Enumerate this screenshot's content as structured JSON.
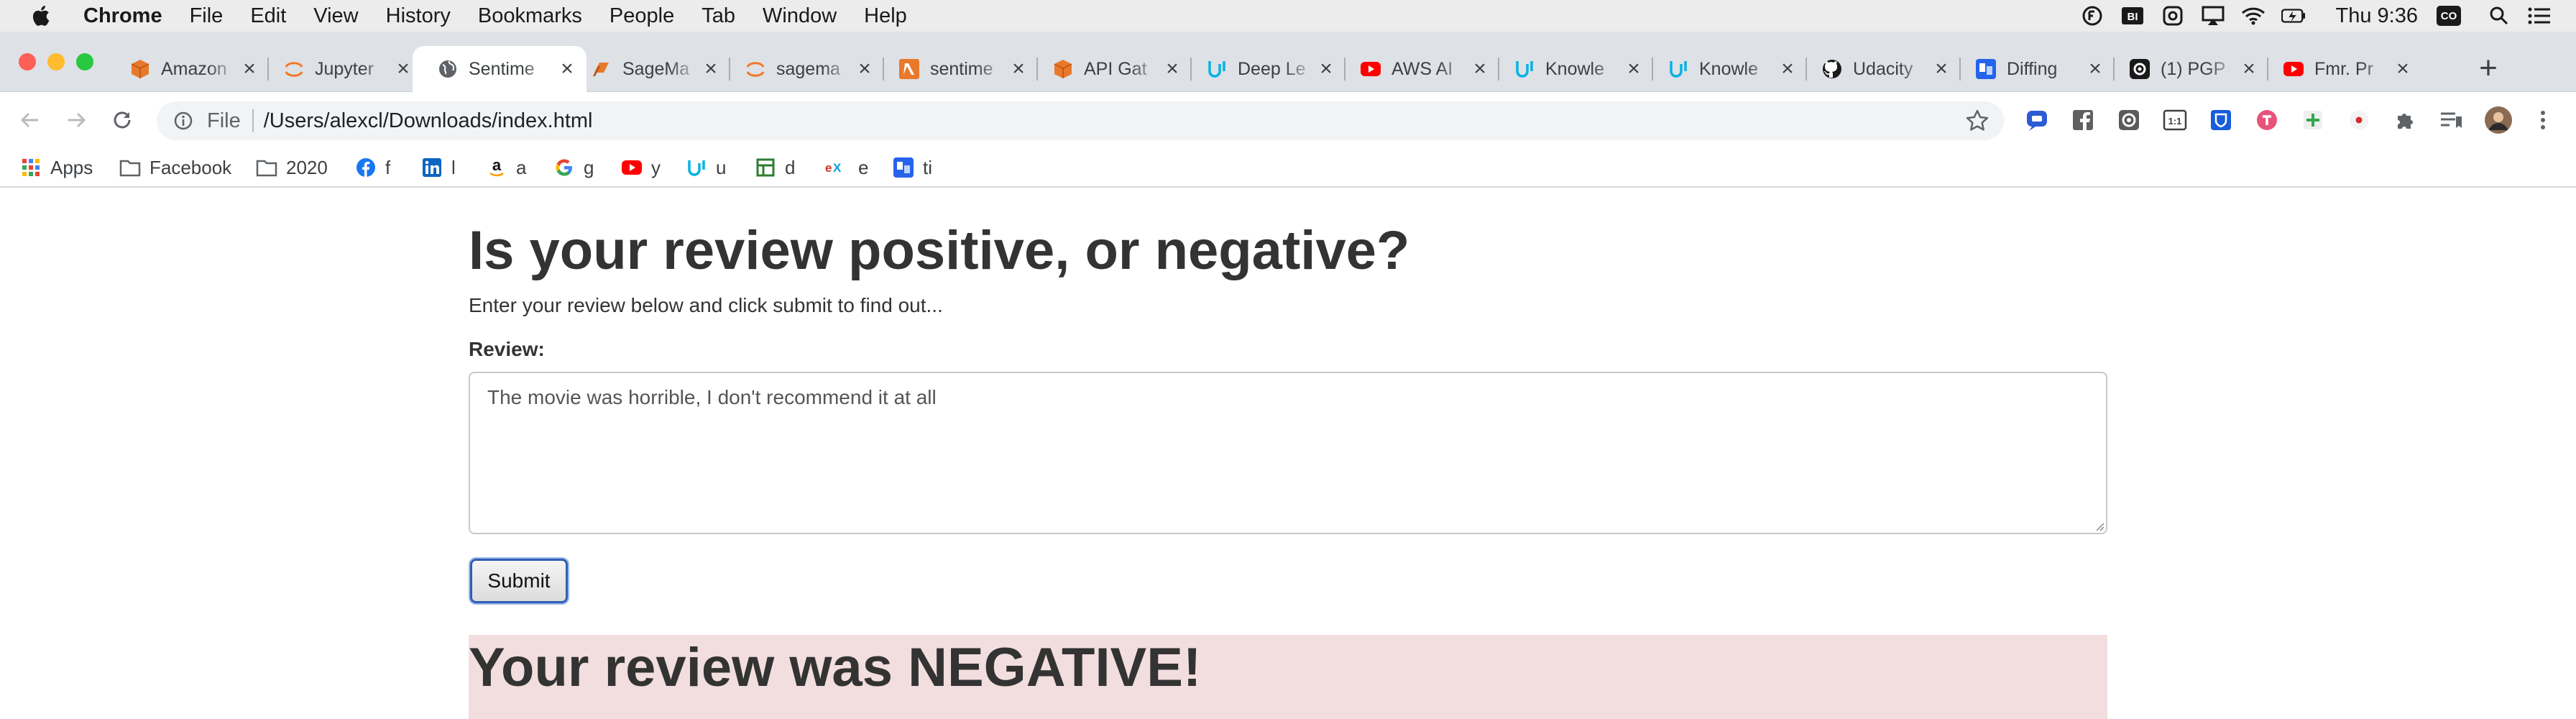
{
  "menubar": {
    "app_name": "Chrome",
    "menus": [
      "File",
      "Edit",
      "View",
      "History",
      "Bookmarks",
      "People",
      "Tab",
      "Window",
      "Help"
    ],
    "clock": "Thu 9:36",
    "user_initials": "CO"
  },
  "tabs": [
    {
      "title": "Amazon",
      "icon": "amazon-box-icon"
    },
    {
      "title": "Jupyter",
      "icon": "jupyter-icon"
    },
    {
      "title": "Sentime",
      "icon": "globe-icon",
      "active": true
    },
    {
      "title": "SageMa",
      "icon": "sagemaker-icon"
    },
    {
      "title": "sagema",
      "icon": "jupyter-icon"
    },
    {
      "title": "sentime",
      "icon": "lambda-icon"
    },
    {
      "title": "API Gat",
      "icon": "amazon-box-icon"
    },
    {
      "title": "Deep Le",
      "icon": "udacity-icon"
    },
    {
      "title": "AWS AI",
      "icon": "youtube-icon"
    },
    {
      "title": "Knowle",
      "icon": "udacity-icon"
    },
    {
      "title": "Knowle",
      "icon": "udacity-icon"
    },
    {
      "title": "Udacity",
      "icon": "github-icon"
    },
    {
      "title": "Diffing",
      "icon": "diff-icon"
    },
    {
      "title": "(1) PGP",
      "icon": "pgp-icon"
    },
    {
      "title": "Fmr. Pr",
      "icon": "youtube-icon"
    }
  ],
  "address_bar": {
    "scheme_label": "File",
    "url": "/Users/alexcl/Downloads/index.html"
  },
  "bookmarks": [
    {
      "label": "Apps",
      "icon": "apps-grid-icon"
    },
    {
      "label": "Facebook",
      "icon": "folder-icon"
    },
    {
      "label": "2020",
      "icon": "folder-icon"
    },
    {
      "label": "f",
      "icon": "facebook-icon"
    },
    {
      "label": "l",
      "icon": "linkedin-icon"
    },
    {
      "label": "a",
      "icon": "amazon-icon"
    },
    {
      "label": "g",
      "icon": "google-icon"
    },
    {
      "label": "y",
      "icon": "youtube-icon"
    },
    {
      "label": "u",
      "icon": "udacity-icon"
    },
    {
      "label": "d",
      "icon": "dictionary-icon"
    },
    {
      "label": "e",
      "icon": "edx-icon"
    },
    {
      "label": "ti",
      "icon": "translate-icon"
    }
  ],
  "page": {
    "title": "Is your review positive, or negative?",
    "subtitle": "Enter your review below and click submit to find out...",
    "review_label": "Review:",
    "review_text": "The movie was horrible, I don't recommend it at all",
    "submit_label": "Submit",
    "result": "Your review was NEGATIVE!"
  },
  "colors": {
    "result_background": "#f2dede",
    "tabstrip": "#dee1e6",
    "focus_ring": "#2f5fb3"
  }
}
